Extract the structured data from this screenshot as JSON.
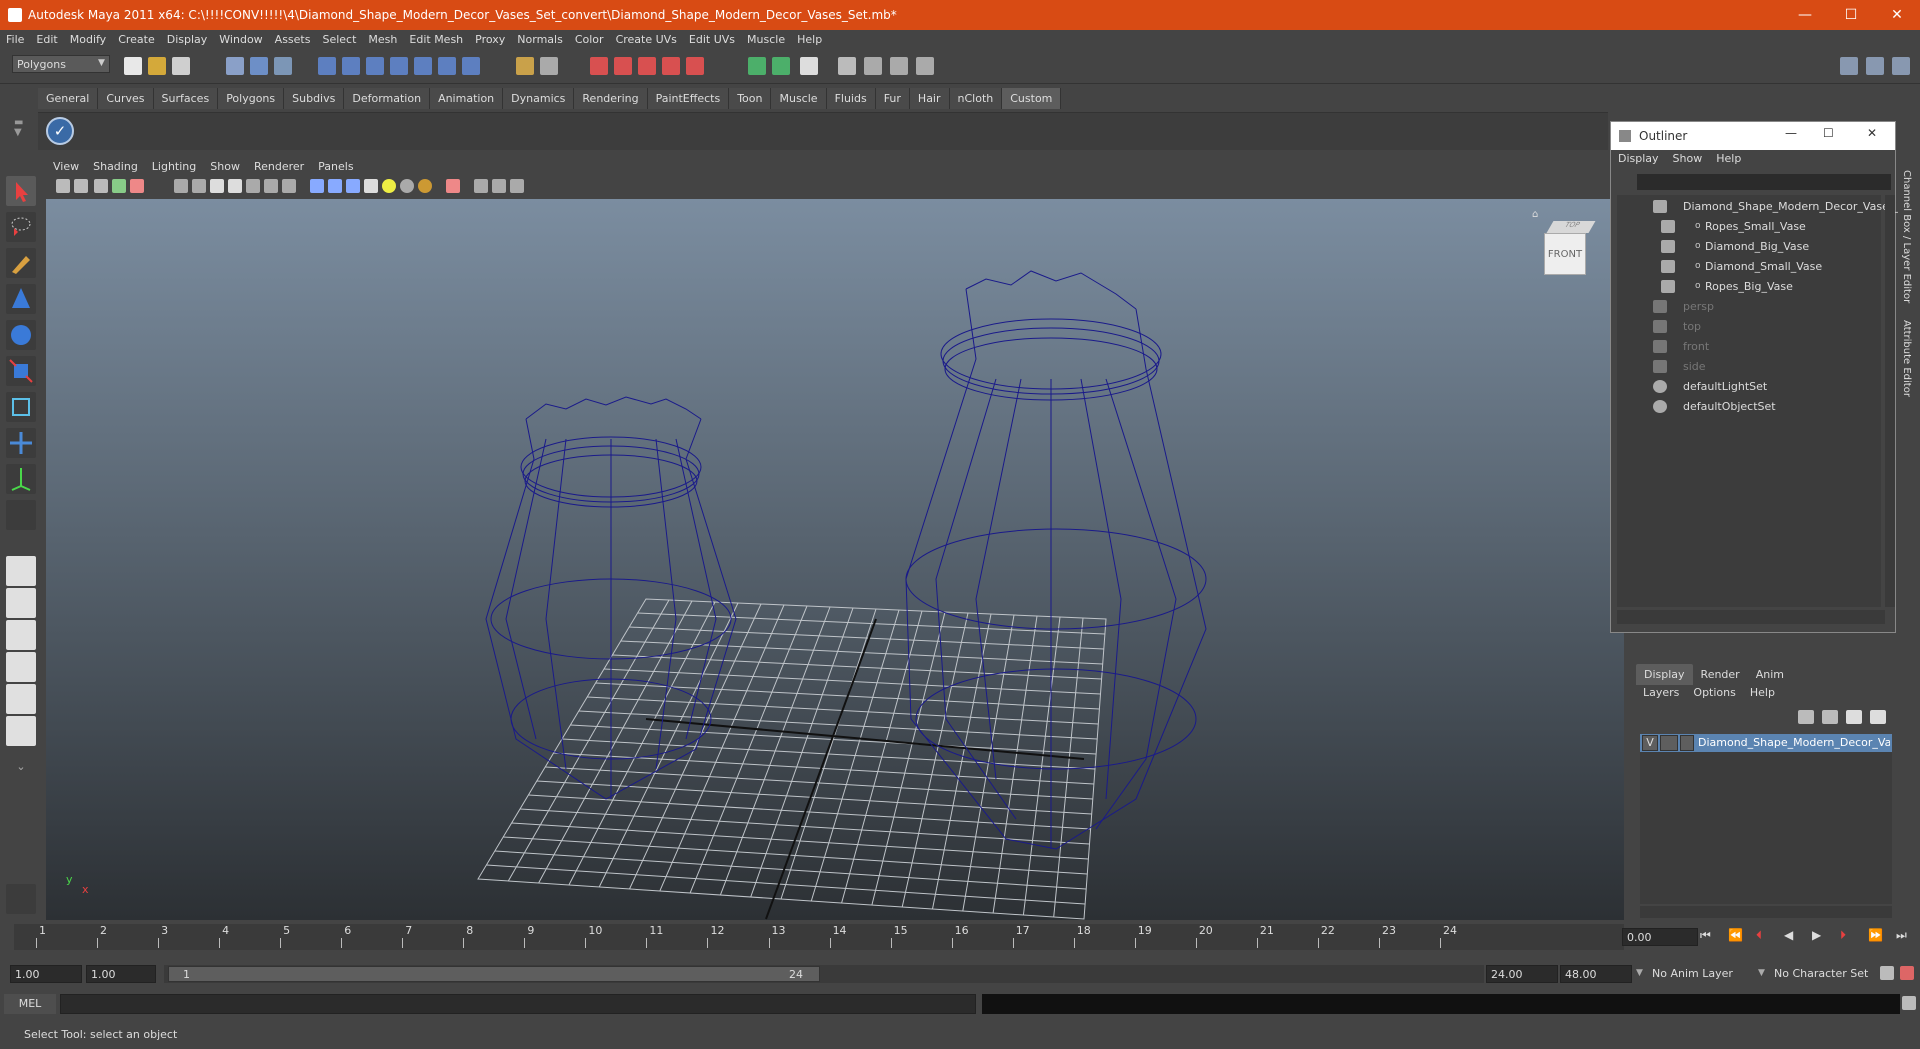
{
  "window": {
    "title": "Autodesk Maya 2011 x64: C:\\!!!!CONV!!!!!\\4\\Diamond_Shape_Modern_Decor_Vases_Set_convert\\Diamond_Shape_Modern_Decor_Vases_Set.mb*",
    "minimize": "—",
    "maximize": "☐",
    "close": "✕"
  },
  "menubar": [
    "File",
    "Edit",
    "Modify",
    "Create",
    "Display",
    "Window",
    "Assets",
    "Select",
    "Mesh",
    "Edit Mesh",
    "Proxy",
    "Normals",
    "Color",
    "Create UVs",
    "Edit UVs",
    "Muscle",
    "Help"
  ],
  "mode_select": "Polygons",
  "shelf_tabs": [
    "General",
    "Curves",
    "Surfaces",
    "Polygons",
    "Subdivs",
    "Deformation",
    "Animation",
    "Dynamics",
    "Rendering",
    "PaintEffects",
    "Toon",
    "Muscle",
    "Fluids",
    "Fur",
    "Hair",
    "nCloth",
    "Custom"
  ],
  "active_shelf": "Custom",
  "viewport": {
    "menu": [
      "View",
      "Shading",
      "Lighting",
      "Show",
      "Renderer",
      "Panels"
    ],
    "viewcube_label": "FRONT",
    "viewcube_top": "TOP",
    "axis_y": "y",
    "axis_x": "x"
  },
  "outliner": {
    "title": "Outliner",
    "menu": [
      "Display",
      "Show",
      "Help"
    ],
    "items": [
      {
        "label": "Diamond_Shape_Modern_Decor_Vases_",
        "dim": false,
        "level": 0
      },
      {
        "label": "Ropes_Small_Vase",
        "dim": false,
        "level": 1
      },
      {
        "label": "Diamond_Big_Vase",
        "dim": false,
        "level": 1
      },
      {
        "label": "Diamond_Small_Vase",
        "dim": false,
        "level": 1
      },
      {
        "label": "Ropes_Big_Vase",
        "dim": false,
        "level": 1
      },
      {
        "label": "persp",
        "dim": true,
        "level": 0
      },
      {
        "label": "top",
        "dim": true,
        "level": 0
      },
      {
        "label": "front",
        "dim": true,
        "level": 0
      },
      {
        "label": "side",
        "dim": true,
        "level": 0
      },
      {
        "label": "defaultLightSet",
        "dim": false,
        "level": 0
      },
      {
        "label": "defaultObjectSet",
        "dim": false,
        "level": 0
      }
    ]
  },
  "right_strip": {
    "channel_box": "Channel Box / Layer Editor",
    "attribute_editor": "Attribute Editor"
  },
  "layer_panel": {
    "tabs": [
      "Display",
      "Render",
      "Anim"
    ],
    "active_tab": "Display",
    "menu": [
      "Layers",
      "Options",
      "Help"
    ],
    "layer_visible": "V",
    "layer_name": "Diamond_Shape_Modern_Decor_Vase"
  },
  "timeline": {
    "ticks": [
      "1",
      "2",
      "3",
      "4",
      "5",
      "6",
      "7",
      "8",
      "9",
      "10",
      "11",
      "12",
      "13",
      "14",
      "15",
      "16",
      "17",
      "18",
      "19",
      "20",
      "21",
      "22",
      "23",
      "24"
    ],
    "current_frame": "0.00"
  },
  "range": {
    "start": "1.00",
    "playback_start": "1.00",
    "slider_start": "1",
    "slider_end": "24",
    "playback_end": "24.00",
    "end": "48.00",
    "anim_layer": "No Anim Layer",
    "character_set": "No Character Set"
  },
  "command": {
    "label": "MEL"
  },
  "help_line": "Select Tool: select an object",
  "colors": {
    "titlebar": "#d84b14",
    "wireframe": "#1a1a8a",
    "selection": "#5b84b1"
  }
}
